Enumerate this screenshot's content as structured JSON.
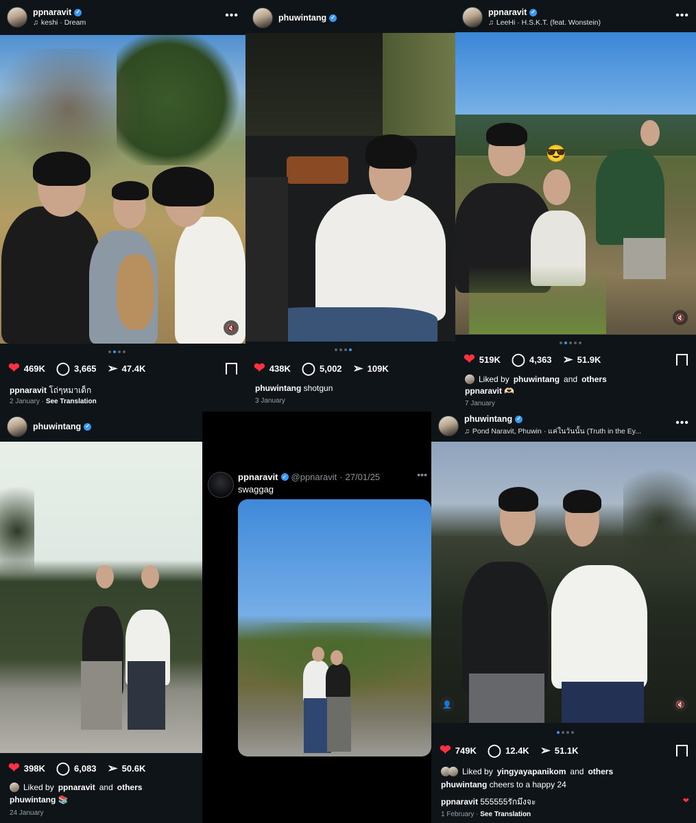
{
  "p1": {
    "user": "ppnaravit",
    "music_icon": "music-note-icon",
    "sub": "keshi · Dream",
    "likes": "469K",
    "comments": "3,665",
    "shares": "47.4K",
    "caption_user": "ppnaravit",
    "caption_text": "โถ่ๆหมาเด็ก",
    "date": "2 January",
    "translate": "See Translation"
  },
  "p2": {
    "user": "phuwintang",
    "likes": "438K",
    "comments": "5,002",
    "shares": "109K",
    "caption_user": "phuwintang",
    "caption_text": "shotgun",
    "date": "3 January"
  },
  "p3": {
    "user": "ppnaravit",
    "sub": "LeeHi · H.S.K.T. (feat. Wonstein)",
    "likes": "519K",
    "comments": "4,363",
    "shares": "51.9K",
    "liked_prefix": "Liked by",
    "liked_user": "phuwintang",
    "liked_and": "and",
    "liked_others": "others",
    "caption_user": "ppnaravit",
    "caption_text": "🫶🏻",
    "date": "7 January"
  },
  "p4": {
    "user": "phuwintang",
    "likes": "398K",
    "comments": "6,083",
    "shares": "50.6K",
    "liked_prefix": "Liked by",
    "liked_user": "ppnaravit",
    "liked_and": "and",
    "liked_others": "others",
    "caption_user": "phuwintang",
    "caption_text": "📚",
    "date": "24 January"
  },
  "p5": {
    "user": "ppnaravit",
    "handle": "@ppnaravit",
    "date": "27/01/25",
    "text": "swaggag"
  },
  "p6": {
    "user": "phuwintang",
    "sub": "Pond Naravit, Phuwin · แค่ในวันนั้น (Truth in the Ey...",
    "likes": "749K",
    "comments": "12.4K",
    "shares": "51.1K",
    "liked_prefix": "Liked by",
    "liked_user": "yingyayapanikom",
    "liked_and": "and",
    "liked_others": "others",
    "caption_user": "phuwintang",
    "caption_text": "cheers to a happy 24",
    "comment_user": "ppnaravit",
    "comment_text": "555555รักมึงจะ",
    "date": "1 February",
    "translate": "See Translation"
  },
  "colors": {
    "bg": "#0f1418",
    "accent": "#3897f0",
    "like": "#ff3040"
  }
}
